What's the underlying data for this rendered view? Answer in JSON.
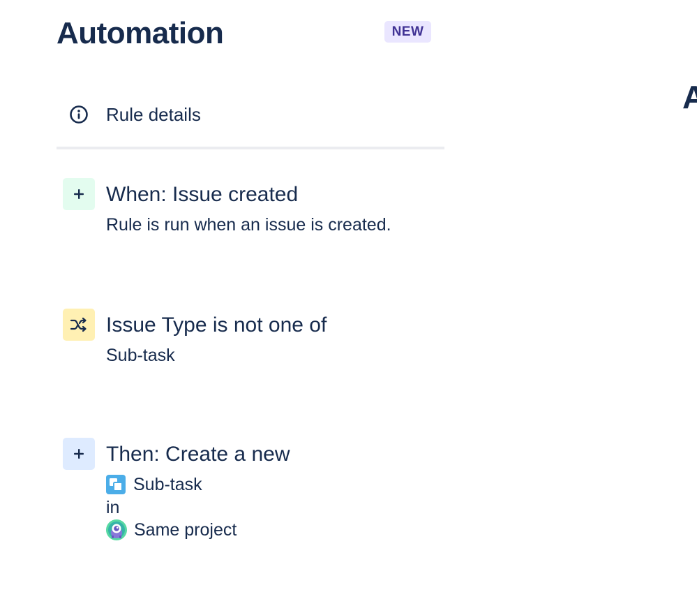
{
  "header": {
    "title": "Automation",
    "badge": "NEW"
  },
  "clipped_heading": "A",
  "rule_details": {
    "label": "Rule details",
    "icon": "info-icon"
  },
  "steps": {
    "trigger": {
      "icon": "plus-icon",
      "title": "When: Issue created",
      "description": "Rule is run when an issue is created."
    },
    "condition": {
      "icon": "shuffle-icon",
      "title": "Issue Type is not one of",
      "description": "Sub-task"
    },
    "action": {
      "icon": "plus-icon",
      "title": "Then: Create a new",
      "issue_type": "Sub-task",
      "connector": "in",
      "project": "Same project"
    }
  },
  "colors": {
    "text": "#172b4d",
    "badge_bg": "#eae6ff",
    "badge_text": "#403294",
    "trigger_bg": "#e3fcef",
    "condition_bg": "#fff0b3",
    "action_bg": "#deebff",
    "subtask_blue": "#4bade8",
    "divider": "#ebecf0"
  }
}
